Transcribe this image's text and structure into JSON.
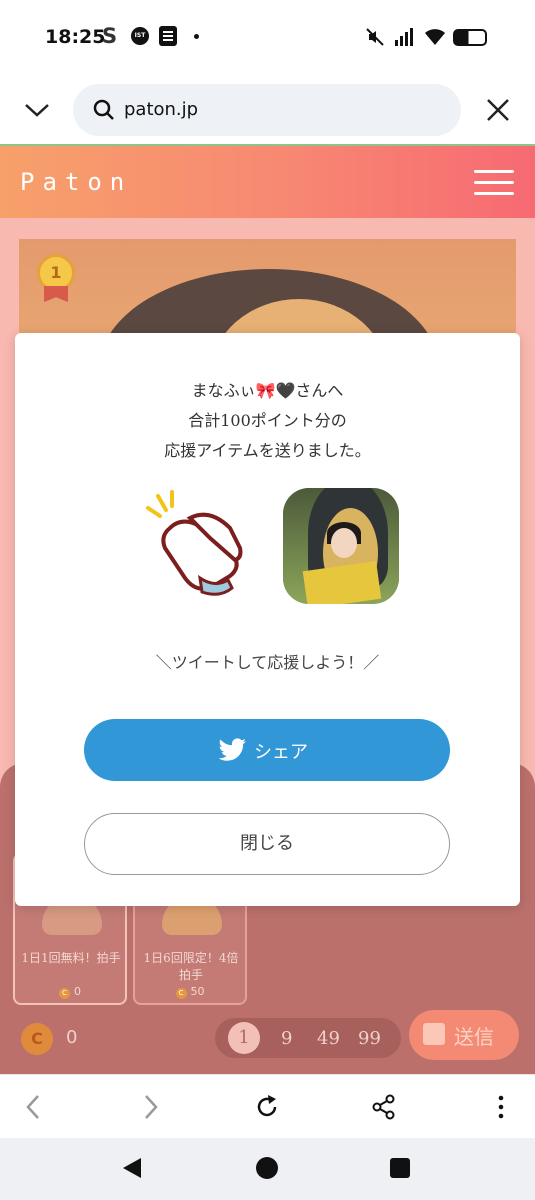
{
  "status_bar": {
    "time": "18:25",
    "s_glyph": "S",
    "ist_badge": "IST"
  },
  "address_bar": {
    "url": "paton.jp"
  },
  "site_header": {
    "logo": "Paton"
  },
  "hero": {
    "rank_badge": "1"
  },
  "gift_cards": [
    {
      "label": "1日1回無料！拍手",
      "cost": "0"
    },
    {
      "label": "1日6回限定！4倍拍手",
      "cost": "50"
    }
  ],
  "coin_bar": {
    "coin_symbol": "C",
    "coin_count": "0",
    "amounts": [
      "1",
      "9",
      "49",
      "99"
    ],
    "send_label": "送信"
  },
  "modal": {
    "line1": "まなふぃ🎀🖤さんへ",
    "line2": "合計100ポイント分の",
    "line3": "応援アイテムを送りました。",
    "tweet_hint": "＼ツイートして応援しよう！／",
    "share_label": "シェア",
    "close_label": "閉じる"
  },
  "colors": {
    "header_gradient_start": "#f7a06a",
    "header_gradient_end": "#f76a72",
    "share_button": "#3197d6",
    "overlay_bg": "#f8b9b0"
  }
}
